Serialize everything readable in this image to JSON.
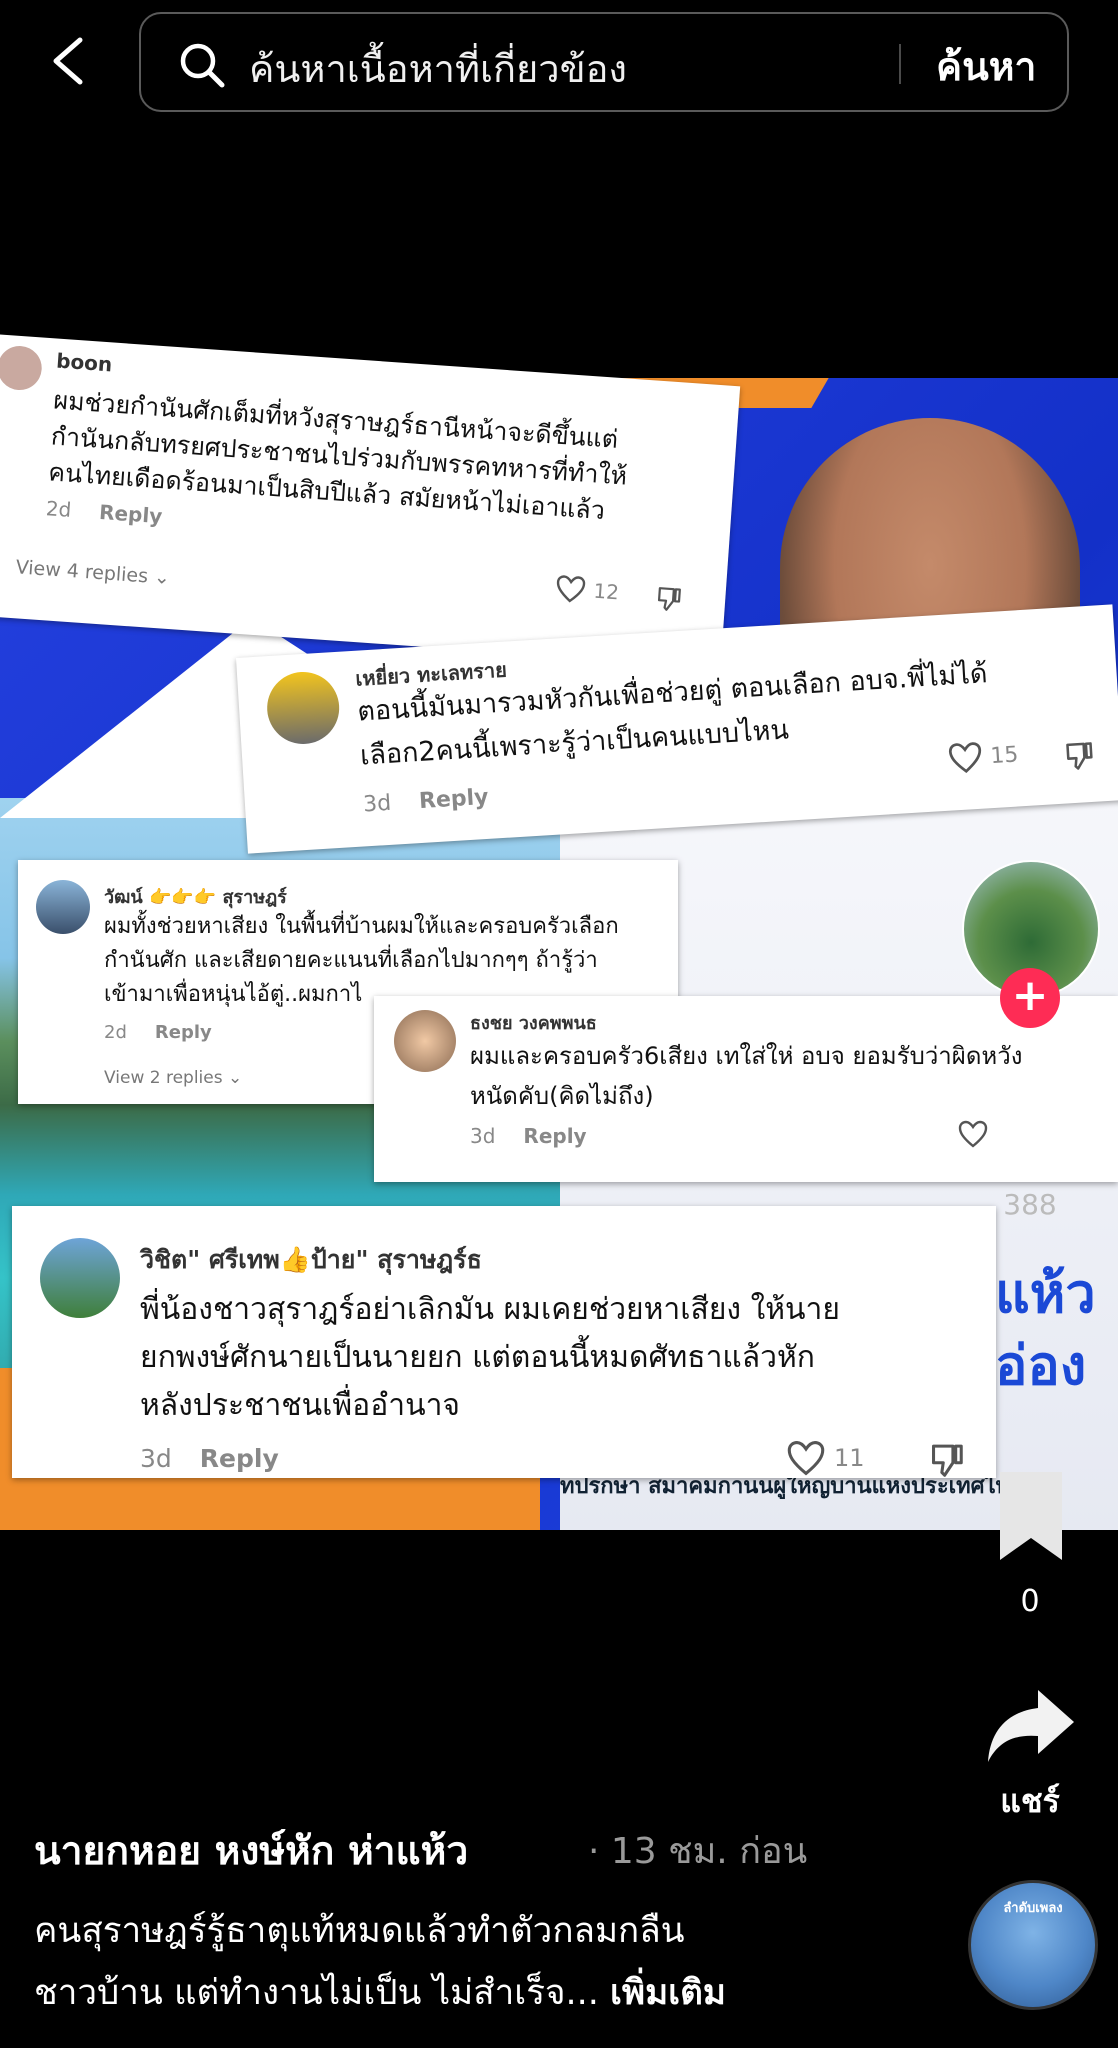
{
  "search": {
    "placeholder": "ค้นหาเนื้อหาที่เกี่ยวข้อง",
    "button_label": "ค้นหา"
  },
  "video": {
    "caption_strip": "ทปรกษา สมาคมกานนผูใหญบานแหงประเทศไทย",
    "big_text": "แห้ว อ่อง"
  },
  "comments": [
    {
      "username": "boon",
      "lines": [
        "ผมช่วยกำนันศักเต็มที่หวังสุราษฎร์ธานีหน้าจะดีขึ้นแต่",
        "กำนันกลับทรยศประชาชนไปร่วมกับพรรคทหารที่ทำให้",
        "คนไทยเดือดร้อนมาเป็นสิบปีแล้ว สมัยหน้าไม่เอาแล้ว"
      ],
      "age": "2d",
      "reply": "Reply",
      "likes": "12",
      "view_replies": "View 4 replies"
    },
    {
      "username": "เหยี่ยว ทะเลทราย",
      "lines": [
        "ตอนนี้มันมารวมหัวกันเพื่อช่วยตู่ ตอนเลือก อบจ.พี่ไม่ได้",
        "เลือก2คนนี้เพราะรู้ว่าเป็นคนแบบไหน"
      ],
      "age": "3d",
      "reply": "Reply",
      "likes": "15"
    },
    {
      "username": "วัฒน์ 👉👉👉 สุราษฎร์",
      "lines": [
        "ผมทั้งช่วยหาเสียง ในพื้นที่บ้านผมให้และครอบครัวเลือก",
        "กำนันศัก และเสียดายคะแนนที่เลือกไปมากๆๆ ถ้ารู้ว่า",
        "เข้ามาเพื่อหนุ่นไอ้ตู่..ผมกาไ"
      ],
      "age": "2d",
      "reply": "Reply",
      "view_replies": "View 2 replies"
    },
    {
      "username": "ธงชย วงคพพนธ",
      "lines": [
        "ผมและครอบครัว6เสียง เทใส่ให่ อบจ ยอมรับว่าผิดหวัง",
        "หนัดคับ(คิดไม่ถึง)"
      ],
      "age": "3d",
      "reply": "Reply"
    },
    {
      "username": "วิชิต\" ศรีเทพ👍ป้าย\" สุราษฎร์ธ",
      "lines": [
        "พี่น้องชาวสุราฎร์อย่าเลิกมัน ผมเคยช่วยหาเสียง ให้นาย",
        "ยกพงษ์ศักนายเป็นนายยก แต่ตอนนี้หมดศัทธาแล้วหัก",
        "หลังประชาชนเพื่ออำนาจ"
      ],
      "age": "3d",
      "reply": "Reply",
      "likes": "11"
    }
  ],
  "rail": {
    "follow": "+",
    "like_count": "388",
    "bookmark_count": "0",
    "share_label": "แชร์"
  },
  "post": {
    "author": "นายกหอย  หงษ์หัก  ห่าแห้ว",
    "time": "· 13 ชม. ก่อน",
    "description_line1": "คนสุราษฎร์รู้ธาตุแท้หมดแล้วทำตัวกลมกลืน",
    "description_line2": "ชาวบ้าน แต่ทำงานไม่เป็น ไม่สำเร็จ... ",
    "more": "เพิ่มเติม",
    "music_label": "ลำดับเพลง"
  },
  "colors": {
    "follow": "#fe2c55",
    "background": "#000000",
    "frame_blue": "#1f3fd8",
    "orange": "#f08d2a"
  }
}
